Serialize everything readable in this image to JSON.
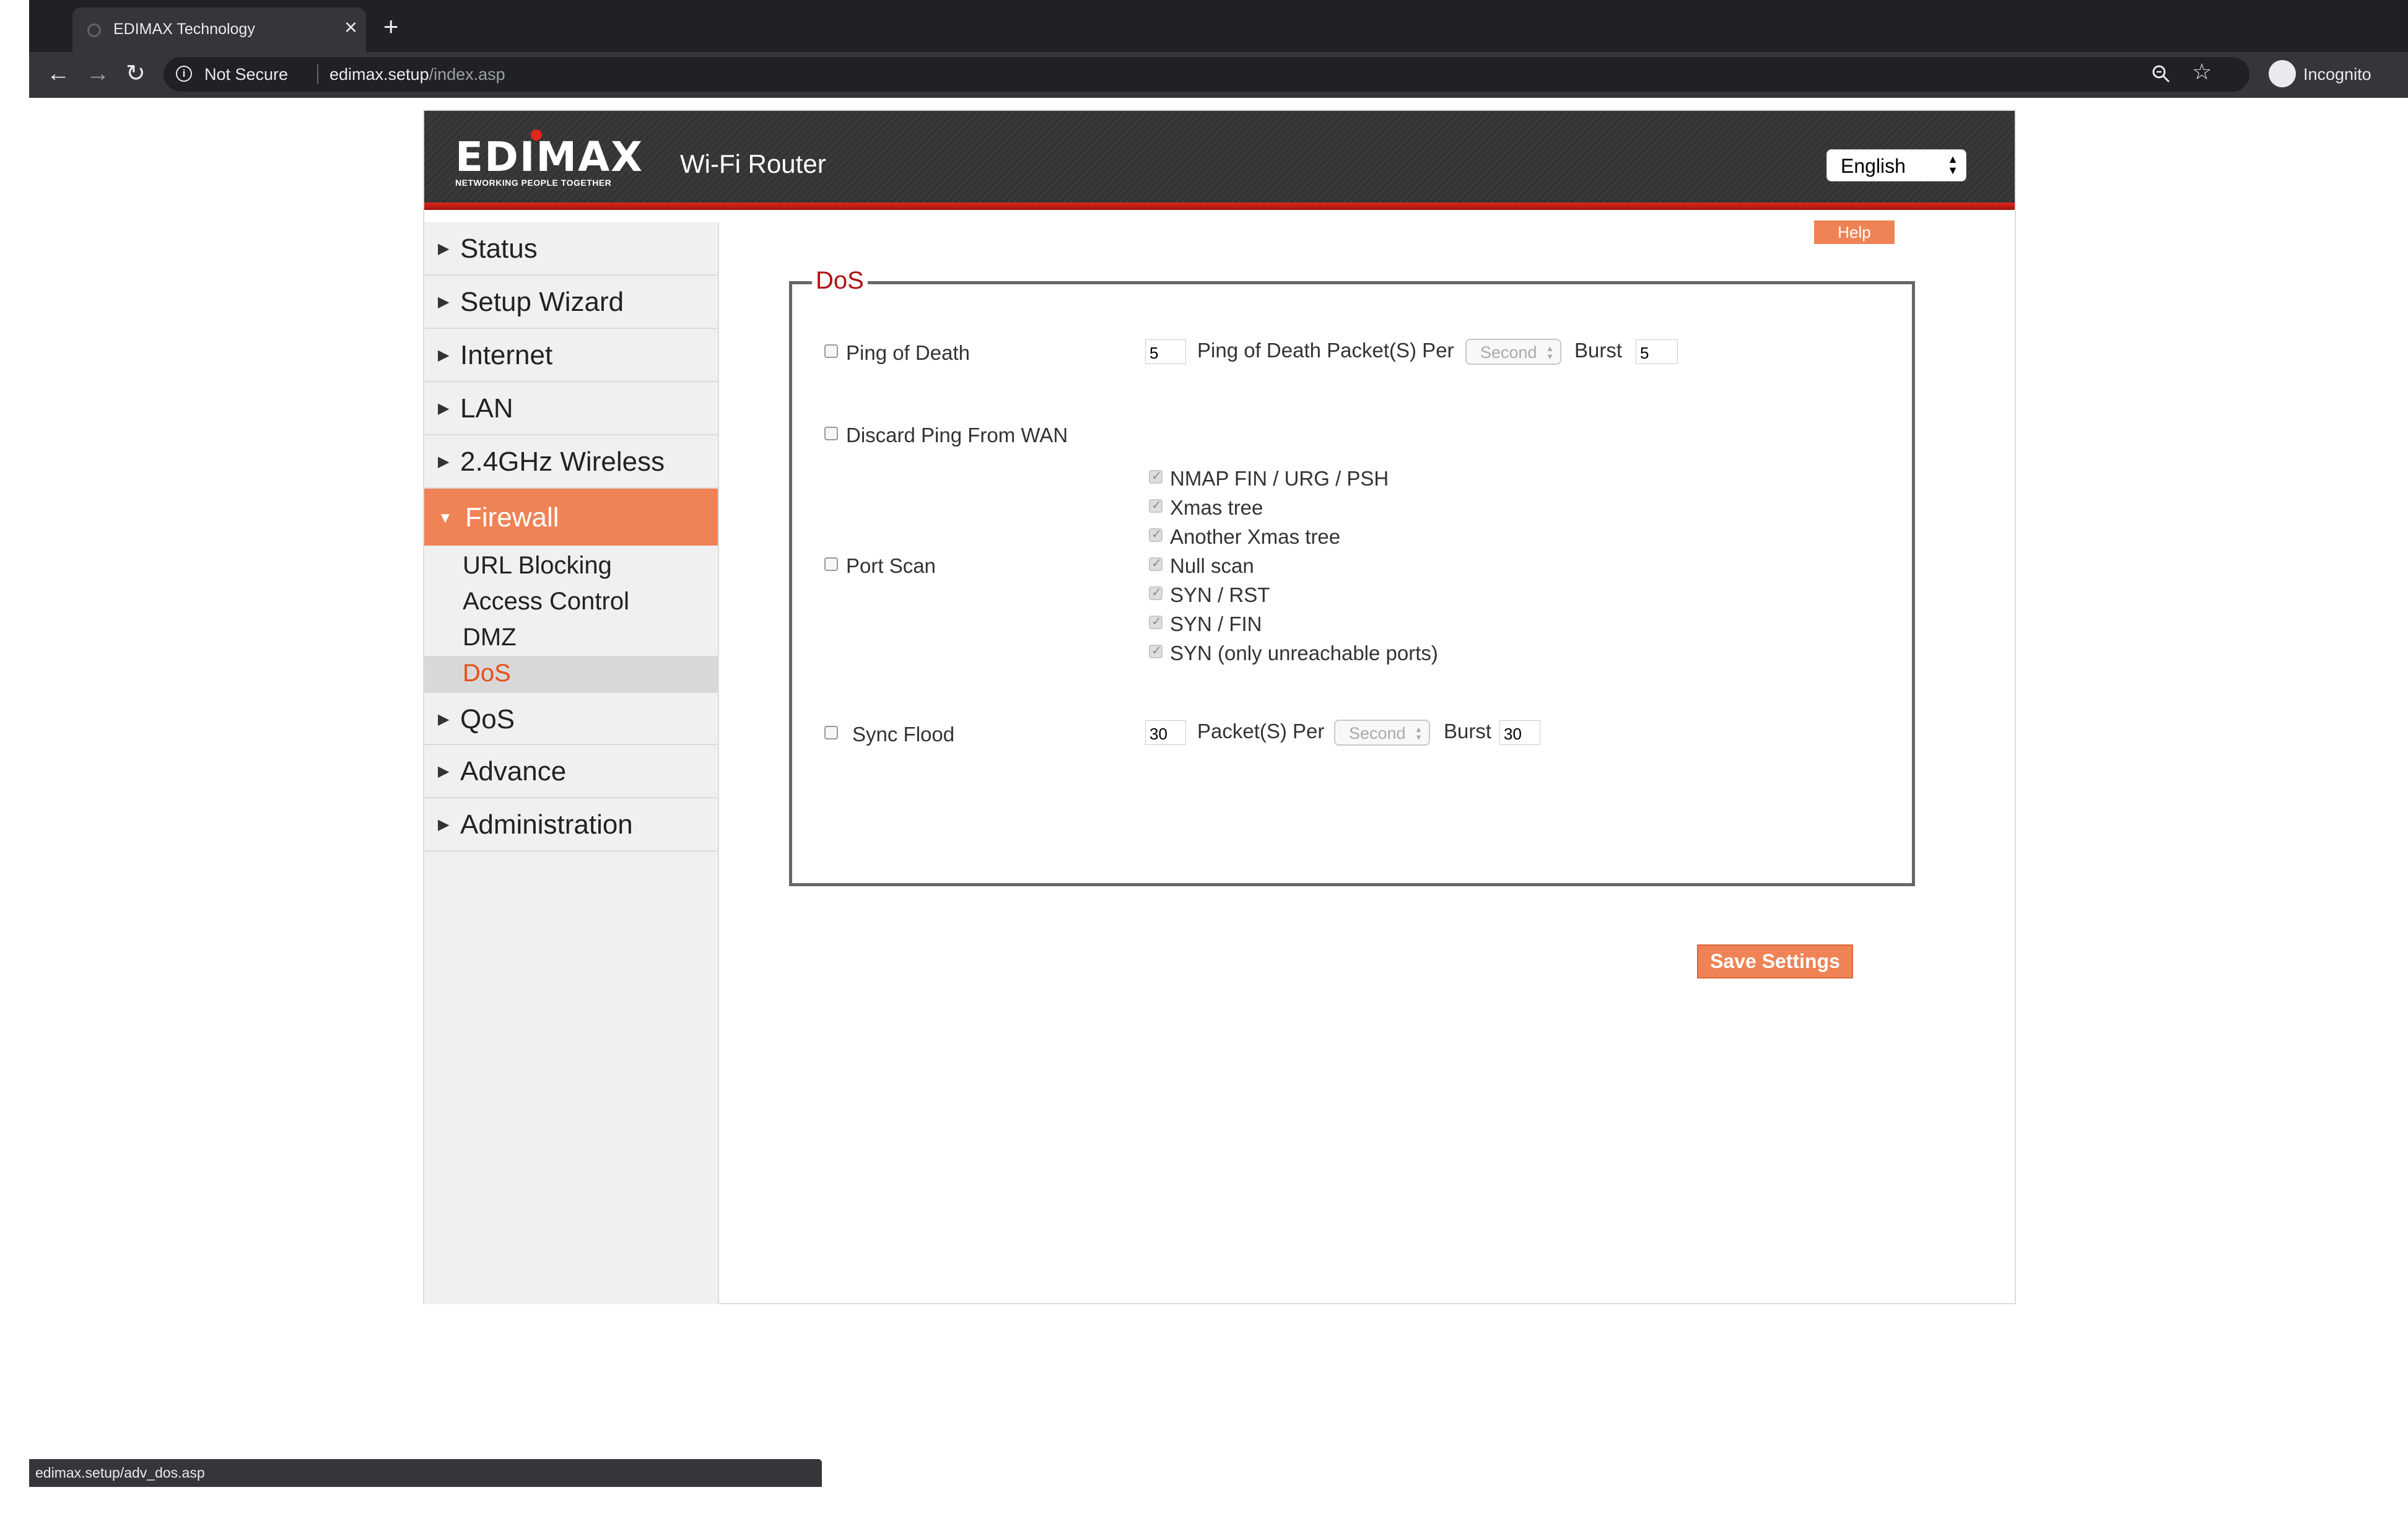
{
  "browser": {
    "tab_title": "EDIMAX Technology",
    "security_label": "Not Secure",
    "url_host": "edimax.setup",
    "url_path": "/index.asp",
    "profile_label": "Incognito",
    "status_url": "edimax.setup/adv_dos.asp"
  },
  "header": {
    "logo_text": "EDIMAX",
    "logo_tagline": "NETWORKING PEOPLE TOGETHER",
    "product_name": "Wi-Fi Router",
    "language": "English"
  },
  "sidebar": {
    "items": [
      {
        "label": "Status"
      },
      {
        "label": "Setup Wizard"
      },
      {
        "label": "Internet"
      },
      {
        "label": "LAN"
      },
      {
        "label": "2.4GHz Wireless"
      },
      {
        "label": "Firewall"
      },
      {
        "label": "QoS"
      },
      {
        "label": "Advance"
      },
      {
        "label": "Administration"
      }
    ],
    "firewall_sub": [
      {
        "label": "URL Blocking"
      },
      {
        "label": "Access Control"
      },
      {
        "label": "DMZ"
      },
      {
        "label": "DoS"
      }
    ]
  },
  "help_label": "Help",
  "dos": {
    "legend": "DoS",
    "ping_of_death": {
      "label": "Ping of Death",
      "checked": false,
      "packets": "5",
      "packets_label": "Ping of Death Packet(S) Per",
      "unit": "Second",
      "burst_label": "Burst",
      "burst": "5"
    },
    "discard_ping": {
      "label": "Discard Ping From WAN",
      "checked": false
    },
    "port_scan": {
      "label": "Port Scan",
      "checked": false,
      "options": [
        {
          "label": "NMAP FIN / URG / PSH",
          "checked": true
        },
        {
          "label": "Xmas tree",
          "checked": true
        },
        {
          "label": "Another Xmas tree",
          "checked": true
        },
        {
          "label": "Null scan",
          "checked": true
        },
        {
          "label": "SYN / RST",
          "checked": true
        },
        {
          "label": "SYN / FIN",
          "checked": true
        },
        {
          "label": "SYN (only unreachable ports)",
          "checked": true
        }
      ]
    },
    "sync_flood": {
      "label": "Sync Flood",
      "checked": false,
      "packets": "30",
      "packets_label": "Packet(S) Per",
      "unit": "Second",
      "burst_label": "Burst",
      "burst": "30"
    },
    "save_label": "Save Settings"
  }
}
